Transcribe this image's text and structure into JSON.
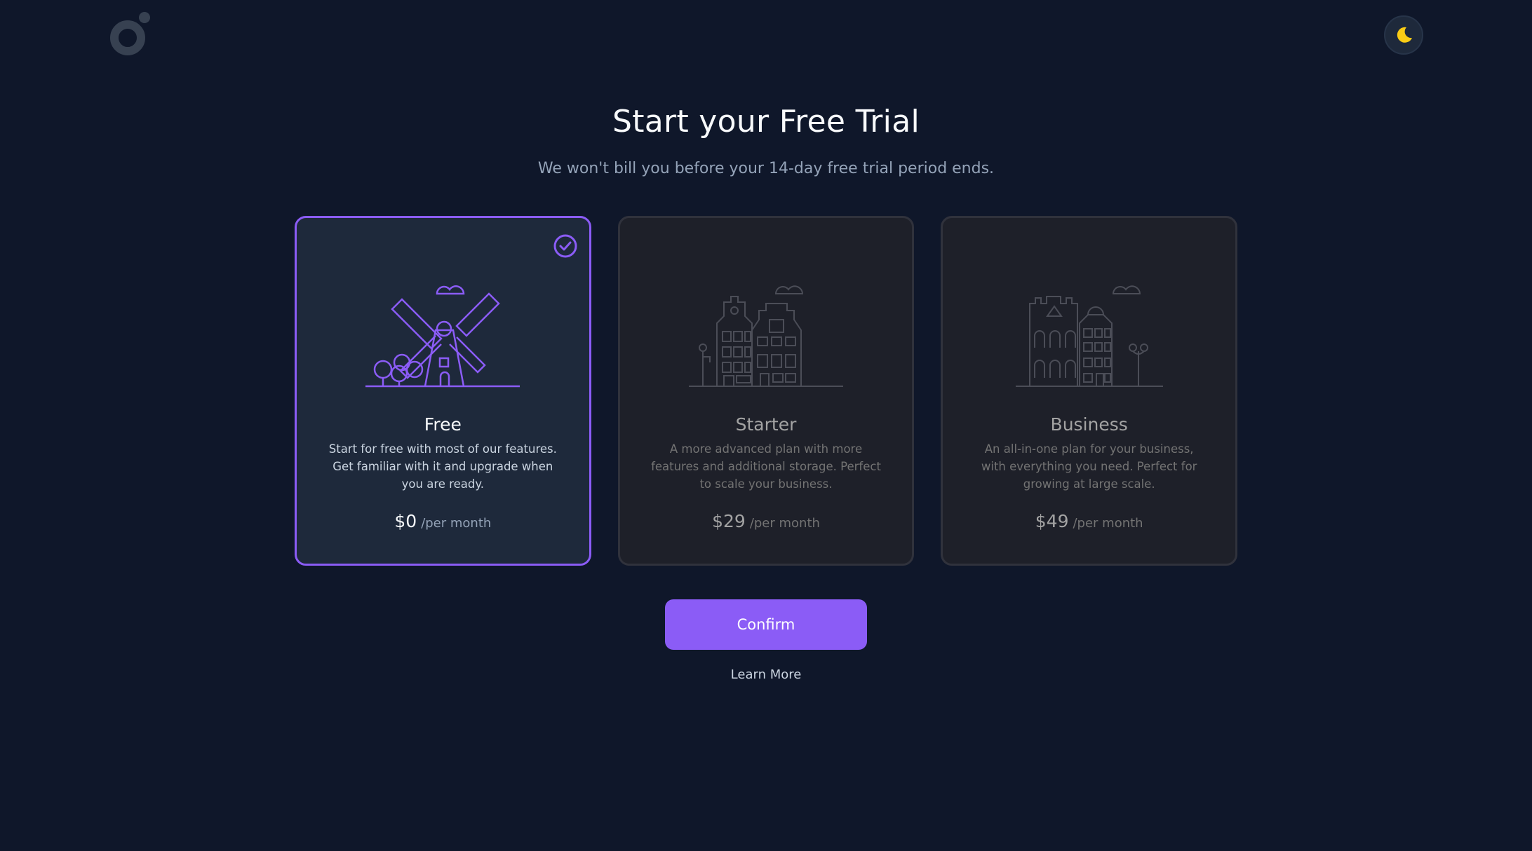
{
  "header": {
    "logo_icon": "brand-logo-icon",
    "theme_toggle_icon": "moon-icon"
  },
  "main": {
    "title": "Start your Free Trial",
    "subtitle": "We won't bill you before your 14-day free trial period ends."
  },
  "plans": [
    {
      "name": "Free",
      "description": "Start for free with most of our features. Get familiar with it and upgrade when you are ready.",
      "price": "$0",
      "period": "/per month",
      "selected": true,
      "illustration_icon": "windmill-illustration-icon"
    },
    {
      "name": "Starter",
      "description": "A more advanced plan with more features and additional storage. Perfect to scale your business.",
      "price": "$29",
      "period": "/per month",
      "selected": false,
      "illustration_icon": "townhouses-illustration-icon"
    },
    {
      "name": "Business",
      "description": "An all-in-one plan for your business, with everything you need. Perfect for growing at large scale.",
      "price": "$49",
      "period": "/per month",
      "selected": false,
      "illustration_icon": "buildings-illustration-icon"
    }
  ],
  "actions": {
    "confirm_label": "Confirm",
    "learn_more_label": "Learn More"
  },
  "colors": {
    "background": "#0f172a",
    "accent": "#8b5cf6",
    "moon": "#facc15"
  }
}
